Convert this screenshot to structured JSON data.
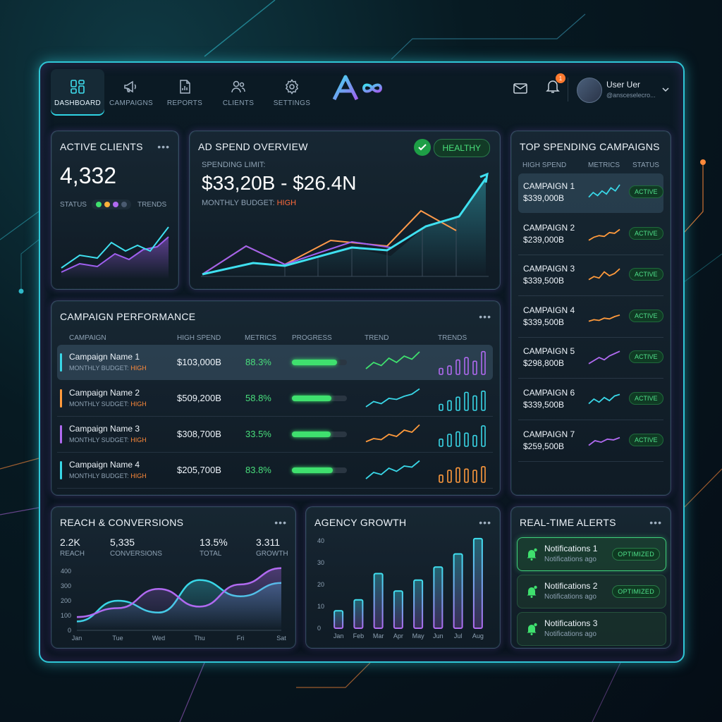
{
  "nav": {
    "items": [
      {
        "label": "DASHBOARD",
        "icon": "dashboard-icon",
        "active": true
      },
      {
        "label": "CAMPAIGNS",
        "icon": "megaphone-icon",
        "active": false
      },
      {
        "label": "REPORTS",
        "icon": "report-icon",
        "active": false
      },
      {
        "label": "CLIENTS",
        "icon": "users-icon",
        "active": false
      },
      {
        "label": "SETTINGS",
        "icon": "gear-icon",
        "active": false
      }
    ]
  },
  "header": {
    "notification_count": "1",
    "user_name": "User Uer",
    "user_sub": "@ansceselecro..."
  },
  "active_clients": {
    "title": "ACTIVE CLIENTS",
    "value": "4,332",
    "status_label": "STATUS",
    "trends_label": "TRENDS",
    "status_colors": [
      "#3fe06e",
      "#ffb23a",
      "#b06af0",
      "#4a5a70"
    ]
  },
  "ad_spend": {
    "title": "AD SPEND OVERVIEW",
    "status": "HEALTHY",
    "limit_label": "SPENDING LIMIT:",
    "limit_value": "$33,20B - $26.4N",
    "budget_label": "MONTHLY BUDGET:",
    "budget_value": "HIGH"
  },
  "top_spending": {
    "title": "TOP SPENDING CAMPAIGNS",
    "columns": [
      "HIGH SPEND",
      "METRICS",
      "STATUS"
    ],
    "rows": [
      {
        "name": "CAMPAIGN 1",
        "amount": "$339,000B",
        "status": "ACTIVE",
        "color": "#39d6e6"
      },
      {
        "name": "CAMPAIGN 2",
        "amount": "$239,000B",
        "status": "ACTIVE",
        "color": "#ff9a3c"
      },
      {
        "name": "CAMPAIGN 3",
        "amount": "$339,500B",
        "status": "ACTIVE",
        "color": "#ff9a3c"
      },
      {
        "name": "CAMPAIGN 4",
        "amount": "$339,500B",
        "status": "ACTIVE",
        "color": "#ff9a3c"
      },
      {
        "name": "CAMPAIGN 5",
        "amount": "$298,800B",
        "status": "ACTIVE",
        "color": "#b06af0"
      },
      {
        "name": "CAMPAIGN 6",
        "amount": "$339,500B",
        "status": "ACTIVE",
        "color": "#39d6e6"
      },
      {
        "name": "CAMPAIGN 7",
        "amount": "$259,500B",
        "status": "ACTIVE",
        "color": "#b06af0"
      }
    ]
  },
  "performance": {
    "title": "CAMPAIGN PERFORMANCE",
    "columns": [
      "CAMPAIGN",
      "HIGH SPEND",
      "METRICS",
      "PROGRESS",
      "TREND",
      "TRENDS"
    ],
    "rows": [
      {
        "name": "Campaign Name 1",
        "budget_label": "MONTHLY BUDGET:",
        "budget_value": "HIGH",
        "amount": "$103,000B",
        "metric": "88.3%",
        "progress": 0.82,
        "accent": "#39d6e6",
        "trend_color": "#3fe06e",
        "bar_color": "#b06af0"
      },
      {
        "name": "Campaign Name 2",
        "budget_label": "MONTHLY SUDGET:",
        "budget_value": "HIGH",
        "amount": "$509,200B",
        "metric": "58.8%",
        "progress": 0.72,
        "accent": "#ff9a3c",
        "trend_color": "#39d6e6",
        "bar_color": "#39d6e6"
      },
      {
        "name": "Campaign Name 3",
        "budget_label": "MONTHLY SUDGET:",
        "budget_value": "HIGH",
        "amount": "$308,700B",
        "metric": "33.5%",
        "progress": 0.7,
        "accent": "#b06af0",
        "trend_color": "#ff9a3c",
        "bar_color": "#39d6e6"
      },
      {
        "name": "Campaign Name 4",
        "budget_label": "MONTHLY BUDGET:",
        "budget_value": "HIGH",
        "amount": "$205,700B",
        "metric": "83.8%",
        "progress": 0.74,
        "accent": "#39d6e6",
        "trend_color": "#39d6e6",
        "bar_color": "#ff9a3c"
      }
    ]
  },
  "reach": {
    "title": "REACH & CONVERSIONS",
    "stats": [
      {
        "value": "2.2K",
        "label": "REACH"
      },
      {
        "value": "5,335",
        "label": "CONVERSIONS"
      },
      {
        "value": "13.5%",
        "label": "TOTAL"
      },
      {
        "value": "3.311",
        "label": "GROWTH"
      }
    ]
  },
  "growth": {
    "title": "AGENCY GROWTH"
  },
  "alerts": {
    "title": "REAL-TIME ALERTS",
    "items": [
      {
        "title": "Notifications 1",
        "sub": "Notifications ago",
        "badge": "OPTIMIZED"
      },
      {
        "title": "Notifications 2",
        "sub": "Notifications ago",
        "badge": "OPTIMIZED"
      },
      {
        "title": "Notifications 3",
        "sub": "Notifications ago",
        "badge": ""
      }
    ]
  },
  "chart_data": [
    {
      "type": "line",
      "title": "REACH & CONVERSIONS",
      "categories": [
        "Jan",
        "Tue",
        "Wed",
        "Thu",
        "Fri",
        "Sat"
      ],
      "ylim": [
        0,
        400
      ],
      "yticks": [
        0,
        100,
        200,
        300,
        400
      ],
      "series": [
        {
          "values": [
            60,
            200,
            120,
            340,
            230,
            320
          ],
          "color": "#39d6e6"
        },
        {
          "values": [
            90,
            150,
            280,
            160,
            310,
            420
          ],
          "color": "#b06af0"
        }
      ]
    },
    {
      "type": "bar",
      "title": "AGENCY GROWTH",
      "categories": [
        "Jan",
        "Feb",
        "Mar",
        "Apr",
        "May",
        "Jun",
        "Jul",
        "Aug"
      ],
      "values": [
        8,
        13,
        25,
        17,
        22,
        28,
        34,
        41
      ],
      "ylim": [
        0,
        40
      ],
      "yticks": [
        0,
        10,
        20,
        30,
        40
      ]
    }
  ]
}
